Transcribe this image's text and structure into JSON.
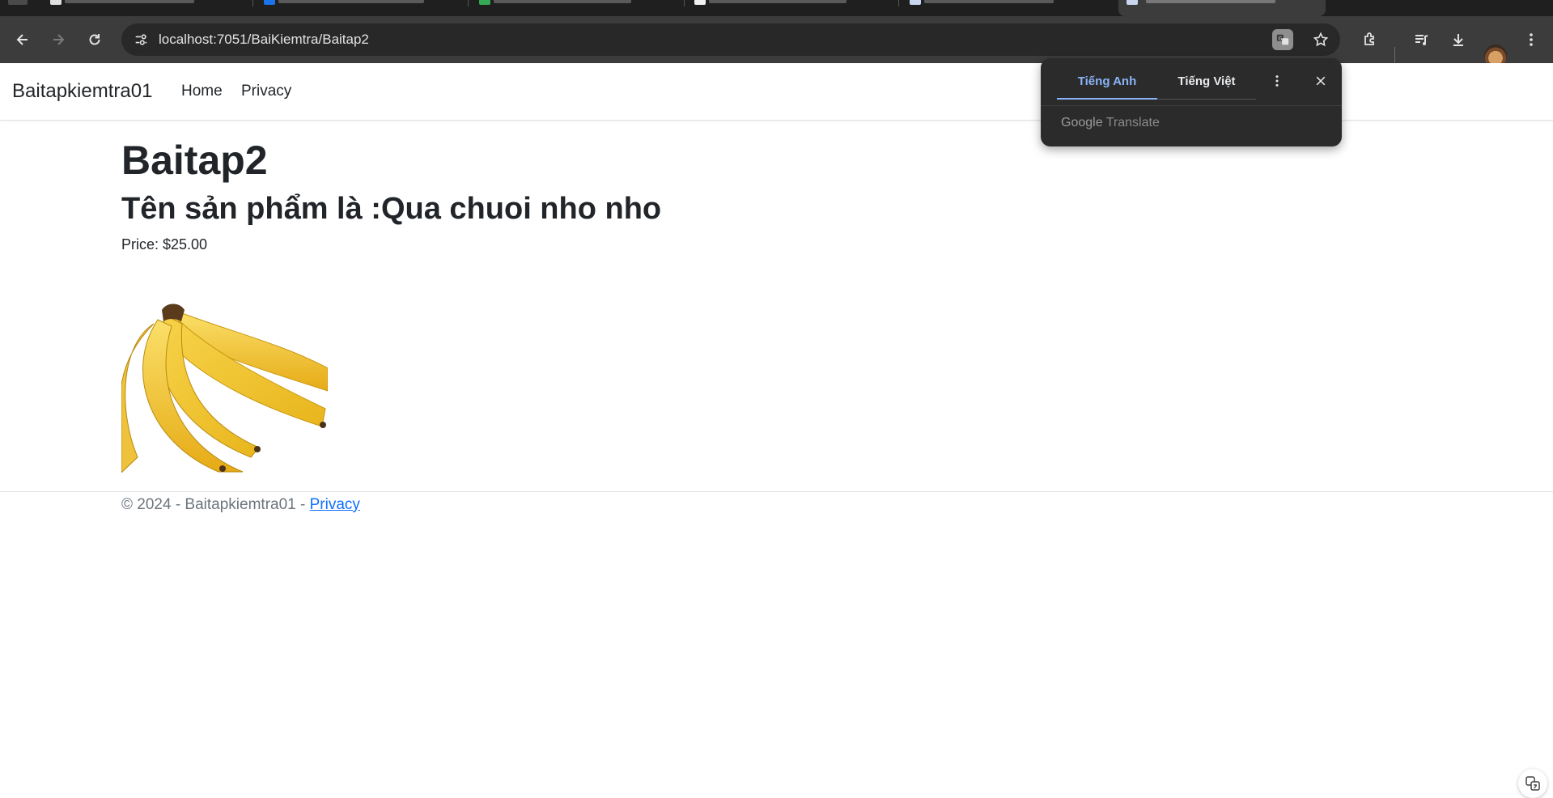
{
  "browser": {
    "url": "localhost:7051/BaiKiemtra/Baitap2",
    "icons": [
      "back-icon",
      "forward-icon",
      "reload-icon",
      "site-info-icon",
      "translate-icon",
      "star-icon",
      "extensions-icon",
      "media-icon",
      "download-icon",
      "menu-icon"
    ]
  },
  "navbar": {
    "brand": "Baitapkiemtra01",
    "links": [
      "Home",
      "Privacy"
    ]
  },
  "main": {
    "title": "Baitap2",
    "product_heading": "Tên sản phẩm là :Qua chuoi nho nho",
    "price": "Price: $25.00",
    "image": "banana-image"
  },
  "footer": {
    "text": "© 2024 - Baitapkiemtra01 - ",
    "link": "Privacy"
  },
  "translate_popup": {
    "tab_active": "Tiếng Anh",
    "tab_inactive": "Tiếng Việt",
    "brand_google": "Google",
    "brand_translate": "Translate",
    "accent_color": "#8ab4f8"
  }
}
